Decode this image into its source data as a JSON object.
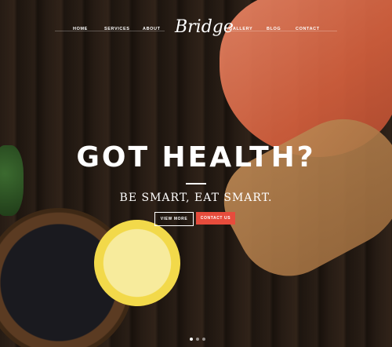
{
  "brand": {
    "logo": "Bridge"
  },
  "nav": {
    "left": [
      "HOME",
      "SERVICES",
      "ABOUT"
    ],
    "right": [
      "GALLERY",
      "BLOG",
      "CONTACT"
    ]
  },
  "hero": {
    "title": "GOT HEALTH?",
    "subtitle": "BE SMART, EAT SMART.",
    "buttons": {
      "view_more": "VIEW MORE",
      "contact_us": "CONTACT US"
    },
    "slides": {
      "count": 3,
      "active": 1
    }
  },
  "colors": {
    "accent": "#e74c3c"
  }
}
